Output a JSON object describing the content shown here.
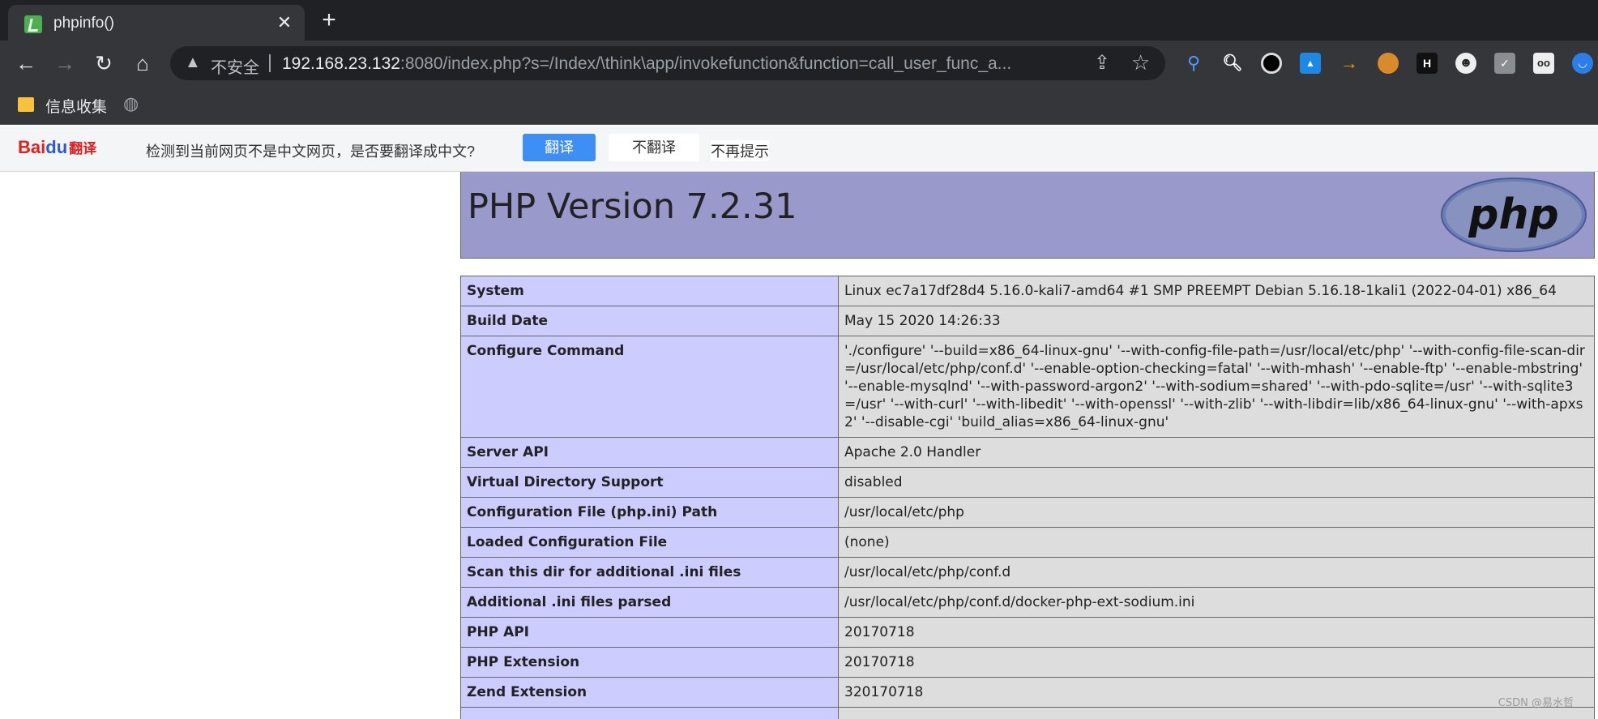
{
  "tab": {
    "title": "phpinfo()",
    "close": "✕",
    "new_tab": "+"
  },
  "toolbar": {
    "back": "←",
    "forward": "→",
    "reload": "↻",
    "home": "⌂",
    "insecure_label": "不安全",
    "url_host": "192.168.23.132",
    "url_rest": ":8080/index.php?s=/Index/\\think\\app/invokefunction&function=call_user_func_a...",
    "extensions": [
      "location-pin-icon",
      "magnifier-icon",
      "circle-icon",
      "image-icon",
      "arrow-icon",
      "cookie-icon",
      "h-icon",
      "ghost-icon",
      "code-icon",
      "glasses-icon",
      "mask-icon"
    ]
  },
  "bookmarks": {
    "folder_label": "信息收集"
  },
  "translate_bar": {
    "logo_bai": "Bai",
    "logo_du": "du",
    "logo_fanyi": "翻译",
    "message": "检测到当前网页不是中文网页，是否要翻译成中文?",
    "translate_button": "翻译",
    "no_translate_button": "不翻译",
    "no_remind": "不再提示"
  },
  "php": {
    "version_title": "PHP Version 7.2.31",
    "logo_text": "php",
    "rows": [
      {
        "key": "System",
        "value": "Linux ec7a17df28d4 5.16.0-kali7-amd64 #1 SMP PREEMPT Debian 5.16.18-1kali1 (2022-04-01) x86_64"
      },
      {
        "key": "Build Date",
        "value": "May 15 2020 14:26:33"
      },
      {
        "key": "Configure Command",
        "value": "'./configure' '--build=x86_64-linux-gnu' '--with-config-file-path=/usr/local/etc/php' '--with-config-file-scan-dir=/usr/local/etc/php/conf.d' '--enable-option-checking=fatal' '--with-mhash' '--enable-ftp' '--enable-mbstring' '--enable-mysqlnd' '--with-password-argon2' '--with-sodium=shared' '--with-pdo-sqlite=/usr' '--with-sqlite3=/usr' '--with-curl' '--with-libedit' '--with-openssl' '--with-zlib' '--with-libdir=lib/x86_64-linux-gnu' '--with-apxs2' '--disable-cgi' 'build_alias=x86_64-linux-gnu'"
      },
      {
        "key": "Server API",
        "value": "Apache 2.0 Handler"
      },
      {
        "key": "Virtual Directory Support",
        "value": "disabled"
      },
      {
        "key": "Configuration File (php.ini) Path",
        "value": "/usr/local/etc/php"
      },
      {
        "key": "Loaded Configuration File",
        "value": "(none)"
      },
      {
        "key": "Scan this dir for additional .ini files",
        "value": "/usr/local/etc/php/conf.d"
      },
      {
        "key": "Additional .ini files parsed",
        "value": "/usr/local/etc/php/conf.d/docker-php-ext-sodium.ini"
      },
      {
        "key": "PHP API",
        "value": "20170718"
      },
      {
        "key": "PHP Extension",
        "value": "20170718"
      },
      {
        "key": "Zend Extension",
        "value": "320170718"
      },
      {
        "key": "",
        "value": ""
      }
    ]
  },
  "watermark": "CSDN @易水哲"
}
